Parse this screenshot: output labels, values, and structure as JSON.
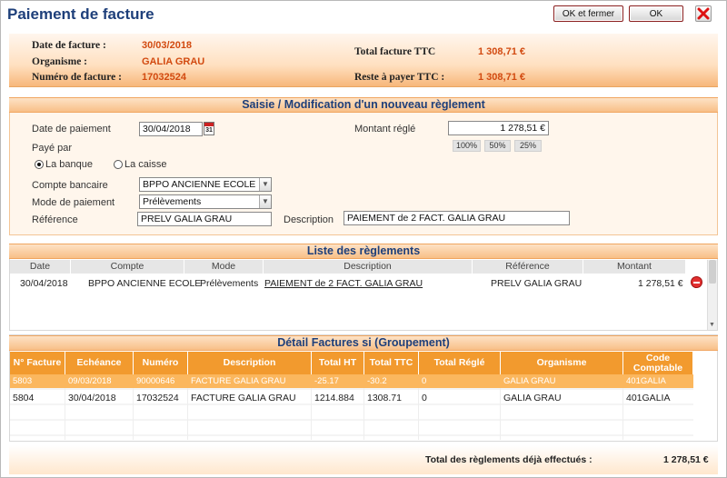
{
  "window": {
    "title": "Paiement de facture",
    "ok_close_label": "OK et fermer",
    "ok_label": "OK"
  },
  "header": {
    "date_label": "Date de facture :",
    "date_value": "30/03/2018",
    "org_label": "Organisme :",
    "org_value": "GALIA GRAU",
    "num_label": "Numéro de facture :",
    "num_value": "17032524",
    "total_label": "Total facture TTC",
    "total_value": "1 308,71 €",
    "reste_label": "Reste à payer TTC :",
    "reste_value": "1 308,71 €"
  },
  "form": {
    "section_title": "Saisie / Modification d'un nouveau règlement",
    "date_label": "Date de paiement",
    "date_value": "30/04/2018",
    "montant_label": "Montant réglé",
    "montant_value": "1 278,51 €",
    "pct_buttons": [
      "100%",
      "50%",
      "25%"
    ],
    "paye_par_label": "Payé par",
    "radio_banque": "La banque",
    "radio_caisse": "La caisse",
    "compte_label": "Compte bancaire",
    "compte_value": "BPPO ANCIENNE ECOLE",
    "mode_label": "Mode de paiement",
    "mode_value": "Prélèvements",
    "ref_label": "Référence",
    "ref_value": "PRELV GALIA GRAU",
    "desc_label": "Description",
    "desc_value": "PAIEMENT de 2 FACT. GALIA GRAU"
  },
  "list": {
    "title": "Liste des règlements",
    "headers": [
      "Date",
      "Compte",
      "Mode",
      "Description",
      "Référence",
      "Montant"
    ],
    "rows": [
      [
        "30/04/2018",
        "BPPO ANCIENNE ECOLE",
        "Prélèvements",
        "PAIEMENT de 2 FACT. GALIA GRAU",
        "PRELV GALIA GRAU",
        "1 278,51 €"
      ]
    ]
  },
  "detail": {
    "title": "Détail Factures si (Groupement)",
    "headers": [
      "N° Facture",
      "Echéance",
      "Numéro",
      "Description",
      "Total HT",
      "Total TTC",
      "Total Réglé",
      "Organisme",
      "Code Comptable"
    ],
    "rows": [
      [
        "5803",
        "09/03/2018",
        "90000646",
        "FACTURE GALIA GRAU",
        "-25.17",
        "-30.2",
        "0",
        "GALIA GRAU",
        "401GALIA"
      ],
      [
        "5804",
        "30/04/2018",
        "17032524",
        "FACTURE GALIA GRAU",
        "1214.884",
        "1308.71",
        "0",
        "GALIA GRAU",
        "401GALIA"
      ]
    ]
  },
  "footer": {
    "label": "Total des règlements déjà effectués :",
    "value": "1 278,51 €"
  },
  "colors": {
    "accent": "#f29a2e",
    "title_blue": "#1e3f7a",
    "value_red": "#d24a10",
    "selected_row": "#fbb75e"
  }
}
